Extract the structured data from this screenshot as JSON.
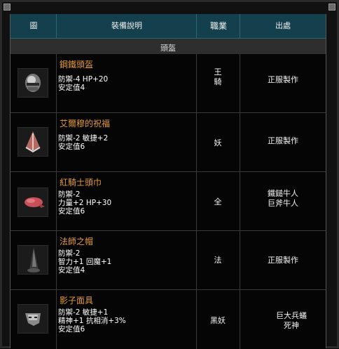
{
  "header": {
    "icon_col": "圖",
    "desc_col": "裝備說明",
    "class_col": "職業",
    "source_col": "出處"
  },
  "section": {
    "title": "頭盔"
  },
  "items": [
    {
      "name": "鋼鐵頭盔",
      "stats": [
        "防禦-4 HP+20",
        "安定值4"
      ],
      "class_lines": [
        "王",
        "騎"
      ],
      "source_lines": [
        "正服製作"
      ],
      "icon": "steel-helmet-icon"
    },
    {
      "name": "艾爾穆的祝福",
      "stats": [
        "防禦-2 敏捷+2",
        "安定值6"
      ],
      "class_lines": [
        "妖"
      ],
      "source_lines": [
        "正服製作"
      ],
      "icon": "elmu-blessing-icon"
    },
    {
      "name": "紅騎士頭巾",
      "stats": [
        "防禦-2",
        "力量+2 HP+30",
        "安定值6"
      ],
      "class_lines": [
        "全"
      ],
      "source_lines": [
        "鐵鎚牛人",
        "巨斧牛人"
      ],
      "icon": "red-bandana-icon"
    },
    {
      "name": "法師之帽",
      "stats": [
        "防禦-2",
        "智力+1 回魔+1",
        "安定值4"
      ],
      "class_lines": [
        "法"
      ],
      "source_lines": [
        "正服製作"
      ],
      "icon": "wizard-hat-icon"
    },
    {
      "name": "影子面具",
      "stats": [
        "防禦-2 敏捷+1",
        "精神+1 抗相消+3%",
        "安定值6"
      ],
      "class_lines": [
        "黑妖"
      ],
      "source_lines": [
        "巨大兵蟻",
        "死神"
      ],
      "icon": "shadow-mask-icon"
    }
  ]
}
